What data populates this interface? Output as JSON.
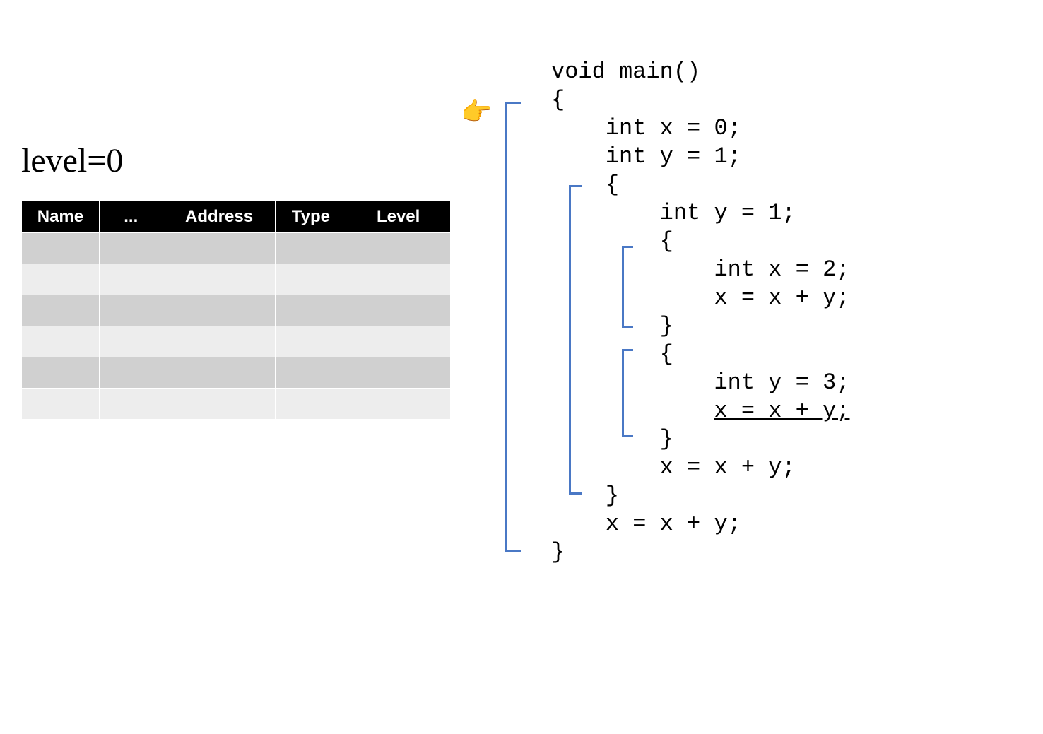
{
  "level_label": "level=0",
  "table": {
    "headers": [
      "Name",
      "...",
      "Address",
      "Type",
      "Level"
    ],
    "rows": [
      [
        "",
        "",
        "",
        "",
        ""
      ],
      [
        "",
        "",
        "",
        "",
        ""
      ],
      [
        "",
        "",
        "",
        "",
        ""
      ],
      [
        "",
        "",
        "",
        "",
        ""
      ],
      [
        "",
        "",
        "",
        "",
        ""
      ],
      [
        "",
        "",
        "",
        "",
        ""
      ]
    ]
  },
  "code": {
    "lines": [
      "void main()",
      "{",
      "    int x = 0;",
      "    int y = 1;",
      "    {",
      "        int y = 1;",
      "        {",
      "            int x = 2;",
      "            x = x + y;",
      "        }",
      "        {",
      "            int y = 3;",
      "            x = x + y;",
      "        }",
      "        x = x + y;",
      "    }",
      "    x = x + y;",
      "}"
    ],
    "underlined_line_index": 12
  },
  "pointer": "👉",
  "brackets": {
    "color": "#4a78c5",
    "nesting_levels": [
      {
        "span_lines": [
          2,
          18
        ],
        "description": "outer function body"
      },
      {
        "span_lines": [
          5,
          16
        ],
        "description": "first inner block"
      },
      {
        "span_lines": [
          7,
          10
        ],
        "description": "second inner block a"
      },
      {
        "span_lines": [
          11,
          14
        ],
        "description": "second inner block b"
      }
    ]
  }
}
